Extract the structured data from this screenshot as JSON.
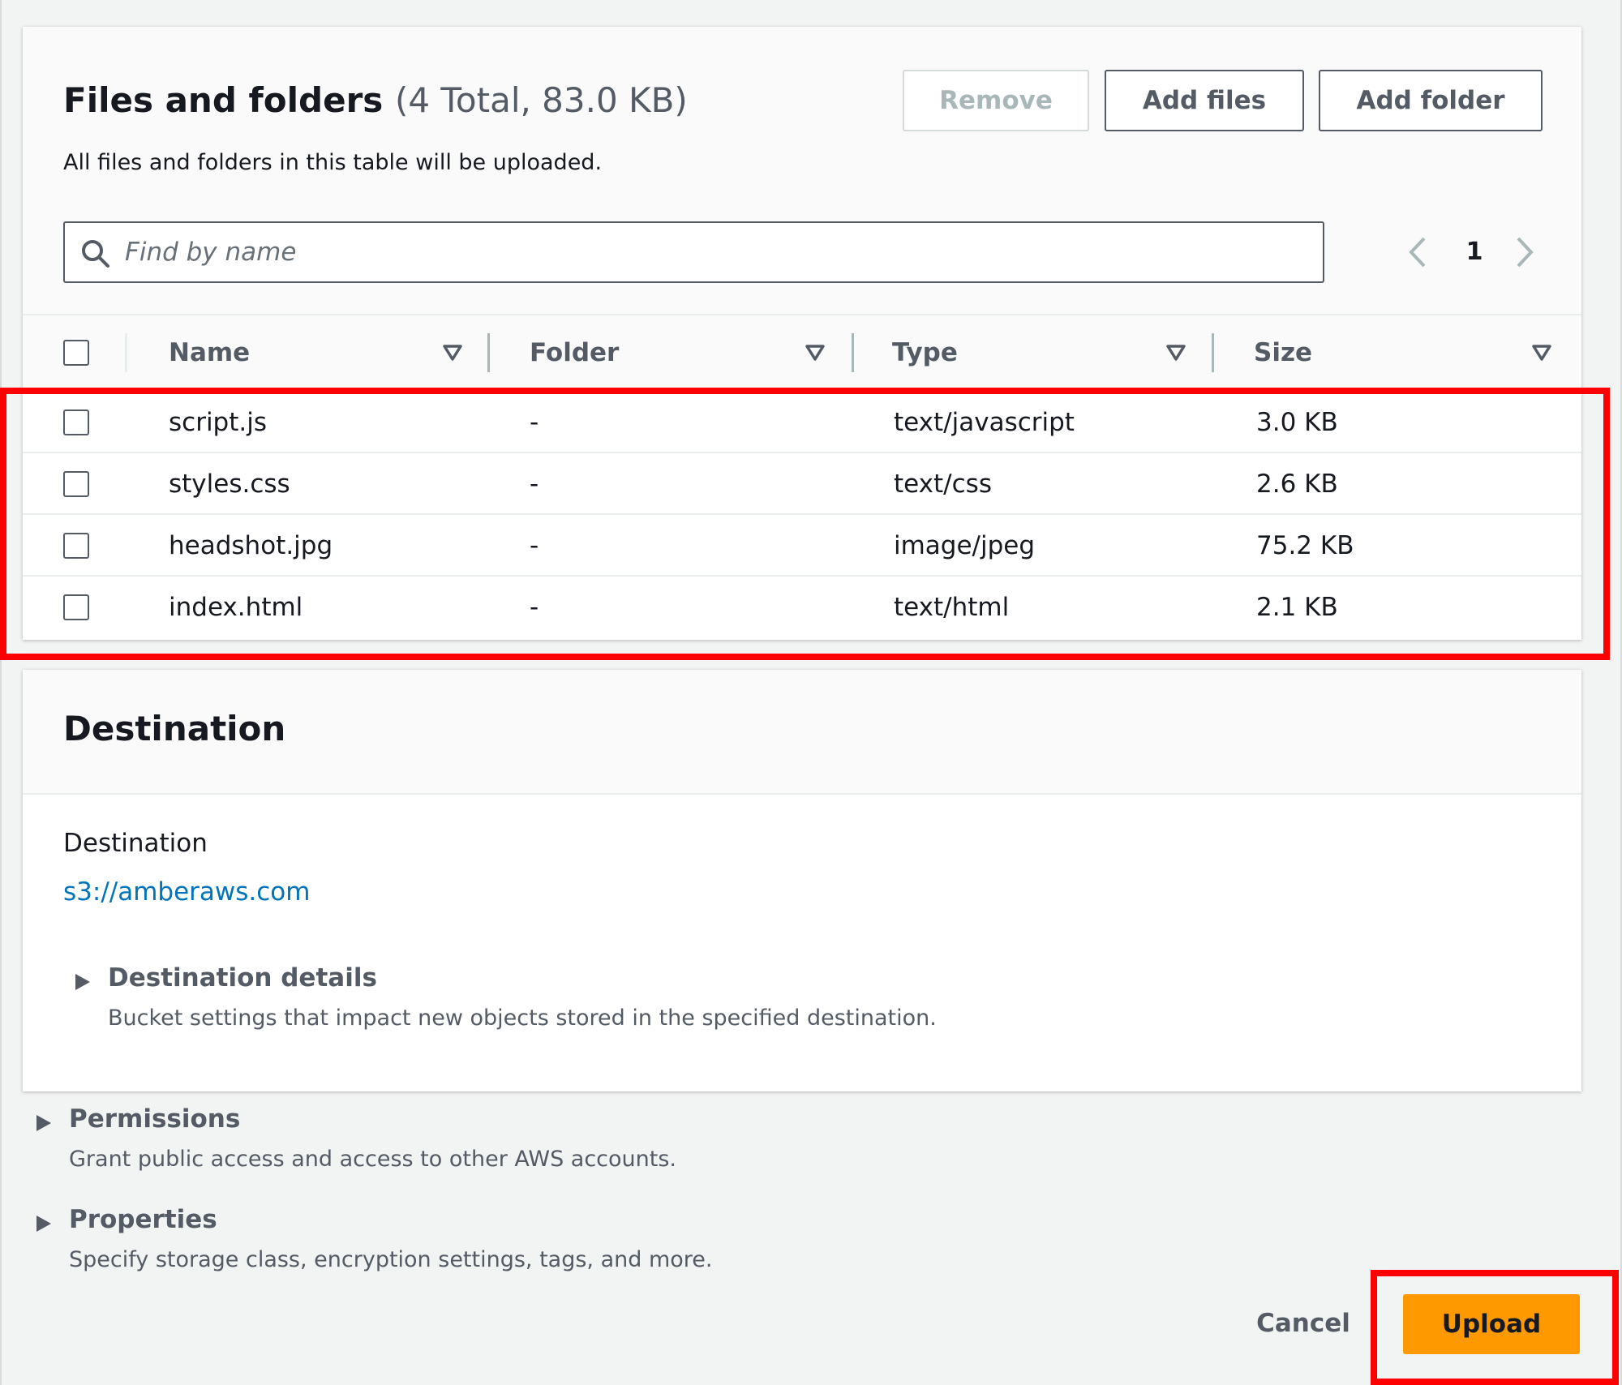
{
  "files": {
    "title": "Files and folders",
    "count": "(4 Total, 83.0 KB)",
    "description": "All files and folders in this table will be uploaded.",
    "buttons": {
      "remove": "Remove",
      "add_files": "Add files",
      "add_folder": "Add folder"
    },
    "search": {
      "placeholder": "Find by name",
      "value": ""
    },
    "pagination": {
      "current_page": "1"
    },
    "columns": [
      "Name",
      "Folder",
      "Type",
      "Size"
    ],
    "rows": [
      {
        "name": "script.js",
        "folder": "-",
        "type": "text/javascript",
        "size": "3.0 KB"
      },
      {
        "name": "styles.css",
        "folder": "-",
        "type": "text/css",
        "size": "2.6 KB"
      },
      {
        "name": "headshot.jpg",
        "folder": "-",
        "type": "image/jpeg",
        "size": "75.2 KB"
      },
      {
        "name": "index.html",
        "folder": "-",
        "type": "text/html",
        "size": "2.1 KB"
      }
    ]
  },
  "destination": {
    "title": "Destination",
    "label": "Destination",
    "link": "s3://amberaws.com",
    "details": {
      "title": "Destination details",
      "description": "Bucket settings that impact new objects stored in the specified destination."
    }
  },
  "permissions": {
    "title": "Permissions",
    "description": "Grant public access and access to other AWS accounts."
  },
  "properties": {
    "title": "Properties",
    "description": "Specify storage class, encryption settings, tags, and more."
  },
  "footer": {
    "cancel": "Cancel",
    "upload": "Upload"
  },
  "colors": {
    "primary_button": "#ff9900",
    "link": "#0073bb",
    "highlight": "#ff0000"
  }
}
